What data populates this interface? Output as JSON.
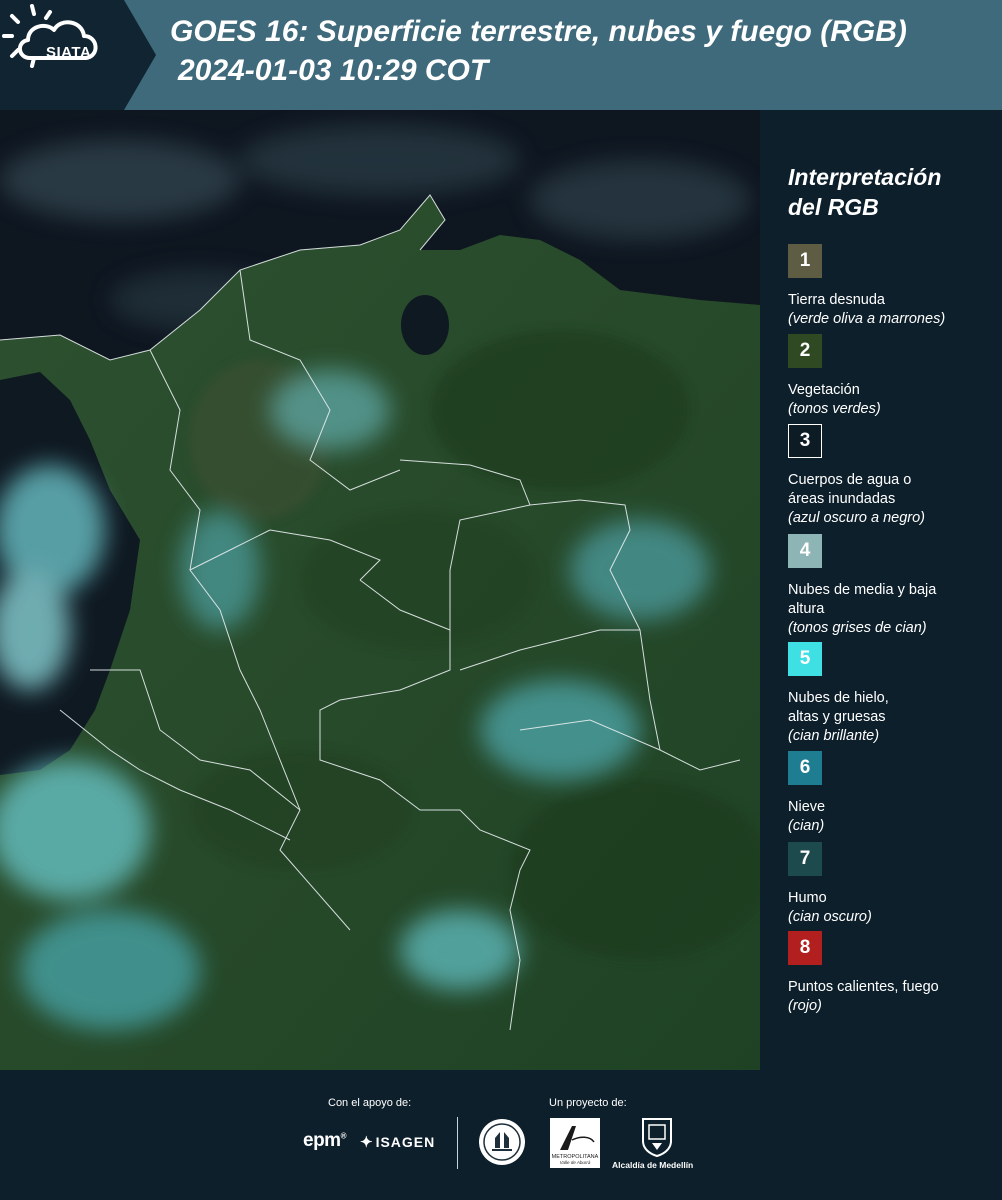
{
  "header": {
    "logo_text": "SIATA",
    "title_line1": "GOES 16: Superficie terrestre, nubes y fuego (RGB)",
    "title_line2": "2024-01-03 10:29 COT"
  },
  "legend": {
    "title_line1": "Interpretación",
    "title_line2": "del RGB",
    "items": [
      {
        "number": "1",
        "color": "#5e5c42",
        "label": "Tierra desnuda",
        "desc": "(verde oliva a marrones)"
      },
      {
        "number": "2",
        "color": "#2f4a22",
        "label": "Vegetación",
        "desc": "(tonos verdes)"
      },
      {
        "number": "3",
        "color": "#0c1b24",
        "label": "Cuerpos de agua o áreas inundadas",
        "desc": "(azul oscuro a negro)"
      },
      {
        "number": "4",
        "color": "#8eb5b6",
        "label": "Nubes de media y baja altura",
        "desc": "(tonos grises de cian)"
      },
      {
        "number": "5",
        "color": "#3fe0e4",
        "label": "Nubes de hielo, altas y gruesas",
        "desc": "(cian brillante)"
      },
      {
        "number": "6",
        "color": "#1f7d91",
        "label": "Nieve",
        "desc": "(cian)"
      },
      {
        "number": "7",
        "color": "#1c4a4d",
        "label": "Humo",
        "desc": "(cian oscuro)"
      },
      {
        "number": "8",
        "color": "#b11f1f",
        "label": "Puntos calientes, fuego",
        "desc": "(rojo)"
      }
    ]
  },
  "footer": {
    "support_label": "Con el apoyo de:",
    "project_label": "Un proyecto de:",
    "epm": "epm",
    "isagen": "ISAGEN",
    "area_line1": "METROPOLITANA",
    "area_line2": "Valle de Aburrá",
    "medellin": "Alcaldía de Medellín"
  }
}
